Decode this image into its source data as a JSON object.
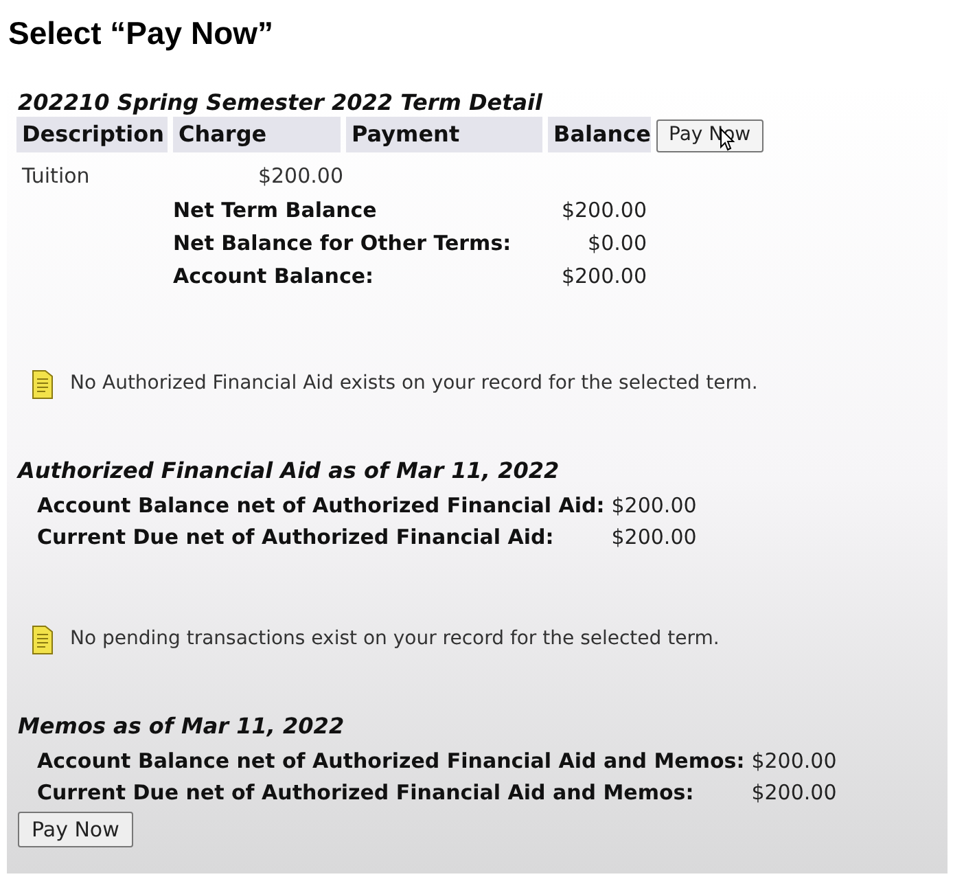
{
  "instruction": "Select “Pay Now”",
  "term_detail": {
    "title": "202210 Spring Semester 2022 Term Detail",
    "columns": [
      "Description",
      "Charge",
      "Payment",
      "Balance"
    ],
    "header_button": "Pay Now",
    "rows": [
      {
        "description": "Tuition",
        "charge": "$200.00"
      }
    ],
    "totals": [
      {
        "label": "Net Term Balance",
        "value": "$200.00"
      },
      {
        "label": "Net Balance for Other Terms:",
        "value": "$0.00"
      },
      {
        "label": "Account Balance:",
        "value": "$200.00"
      }
    ]
  },
  "aid_notice": "No Authorized Financial Aid exists on your record for the selected term.",
  "authorized_aid": {
    "title": "Authorized Financial Aid as of Mar 11, 2022",
    "rows": [
      {
        "label": "Account Balance net of Authorized Financial Aid:",
        "value": "$200.00"
      },
      {
        "label": "Current Due net of Authorized Financial Aid:",
        "value": "$200.00"
      }
    ]
  },
  "pending_notice": "No pending transactions exist on your record for the selected term.",
  "memos": {
    "title": "Memos as of Mar 11, 2022",
    "rows": [
      {
        "label": "Account Balance net of Authorized Financial Aid and Memos:",
        "value": "$200.00"
      },
      {
        "label": "Current Due net of Authorized Financial Aid and Memos:",
        "value": "$200.00"
      }
    ]
  },
  "footer_button": "Pay Now"
}
